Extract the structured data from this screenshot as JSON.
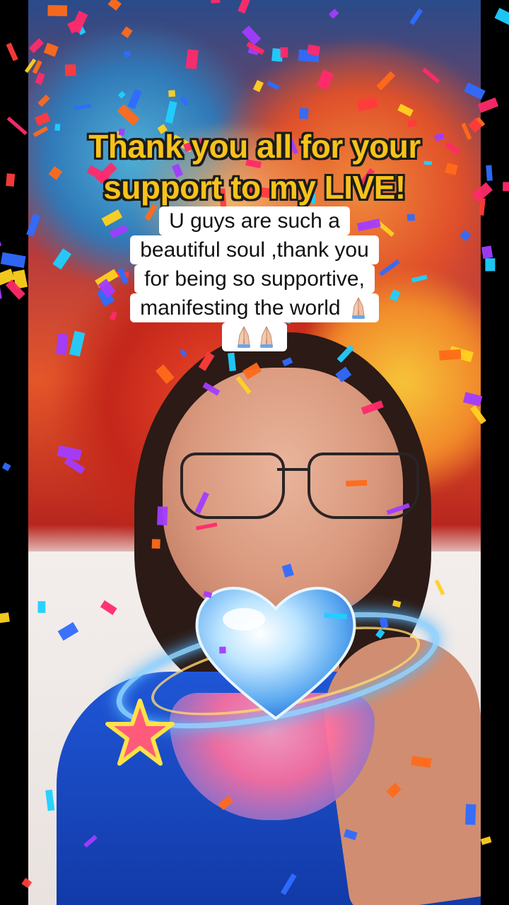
{
  "headline": {
    "line1": "Thank you all for your",
    "line2": "support to my LIVE!"
  },
  "caption": {
    "lines": [
      "U guys are such a",
      "beautiful soul ,thank you",
      "for being so supportive,",
      "manifesting the world"
    ],
    "emoji": "folded-hands-icon",
    "trailing_emoji_count": 2
  },
  "colors": {
    "headline_fill": "#f8c21a",
    "headline_outline": "#1c1c1c",
    "caption_background": "#ffffff",
    "shirt": "#1f56d6"
  },
  "effects": {
    "overlay": "heart-in-hands",
    "confetti": true
  }
}
